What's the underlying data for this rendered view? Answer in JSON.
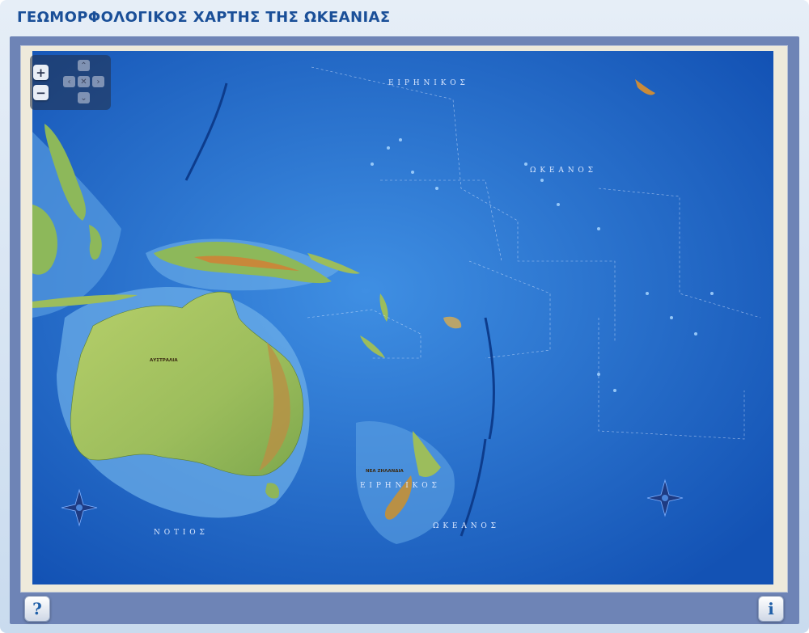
{
  "header": {
    "title": "ΓΕΩΜΟΡΦΟΛΟΓΙΚΟΣ ΧΑΡΤΗΣ ΤΗΣ ΩΚΕΑΝΙΑΣ"
  },
  "map": {
    "ocean_label_pacific_north": "Ε Ι Ρ Η Ν Ι Κ Ο Σ",
    "ocean_label_pacific_ocean": "Ω Κ Ε Α Ν Ο Σ",
    "ocean_label_south": "Ν Ο Τ Ι Ο Σ",
    "ocean_label_south_pacific": "Ε Ι Ρ Η Ν Ι Κ Ο Σ",
    "ocean_label_south_ocean": "Ω Κ Ε Α Ν Ο Σ",
    "country_australia": "ΑΥΣΤΡΑΛΙΑ",
    "country_new_zealand": "ΝΕΑ ΖΗΛΑΝΔΙΑ",
    "colors": {
      "deep_ocean": "#1a5ec2",
      "shallow_ocean": "#4f9be6",
      "lowland": "#9fc25a",
      "highland": "#c98b3a"
    }
  },
  "controls": {
    "zoom_in": "+",
    "zoom_out": "−",
    "pan_up": "⌃",
    "pan_down": "⌄",
    "pan_left": "‹",
    "pan_right": "›",
    "pan_reset": "✕"
  },
  "footer": {
    "help_label": "?",
    "info_label": "i"
  }
}
